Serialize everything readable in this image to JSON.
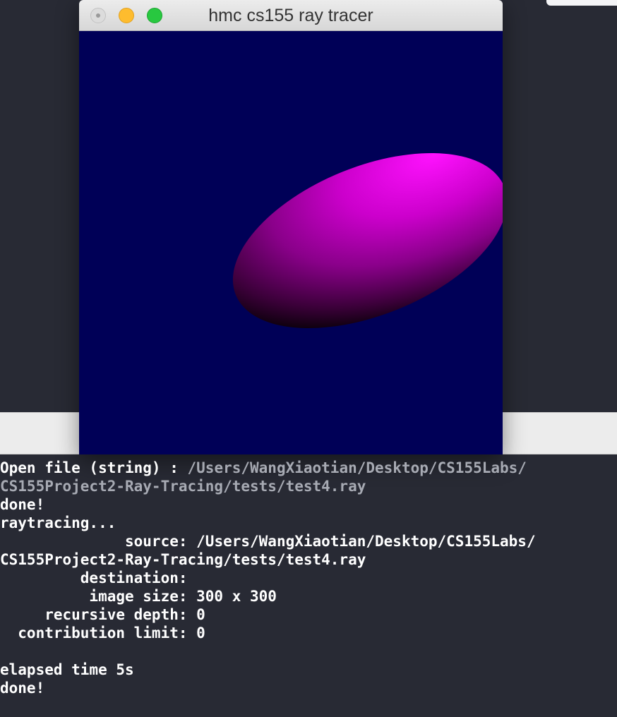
{
  "window": {
    "title": "hmc cs155 ray tracer",
    "buttons": {
      "close": "close",
      "minimize": "minimize",
      "maximize": "maximize"
    },
    "render": {
      "background_color": "#000057",
      "object": "ellipsoid",
      "object_color": "#ff00ff"
    }
  },
  "terminal": {
    "open_label": "Open file (string) : ",
    "open_path_1": "/Users/WangXiaotian/Desktop/CS155Labs/",
    "open_path_2": "CS155Project2-Ray-Tracing/tests/test4.ray",
    "done1": "done!",
    "raytracing": "raytracing...",
    "source_label": "              source: ",
    "source_path_1": "/Users/WangXiaotian/Desktop/CS155Labs/",
    "source_path_2": "CS155Project2-Ray-Tracing/tests/test4.ray",
    "destination": "         destination:",
    "image_size": "          image size: 300 x 300",
    "recursive_depth": "     recursive depth: 0",
    "contribution_limit": "  contribution limit: 0",
    "elapsed": "elapsed time 5s",
    "done2": "done!"
  }
}
